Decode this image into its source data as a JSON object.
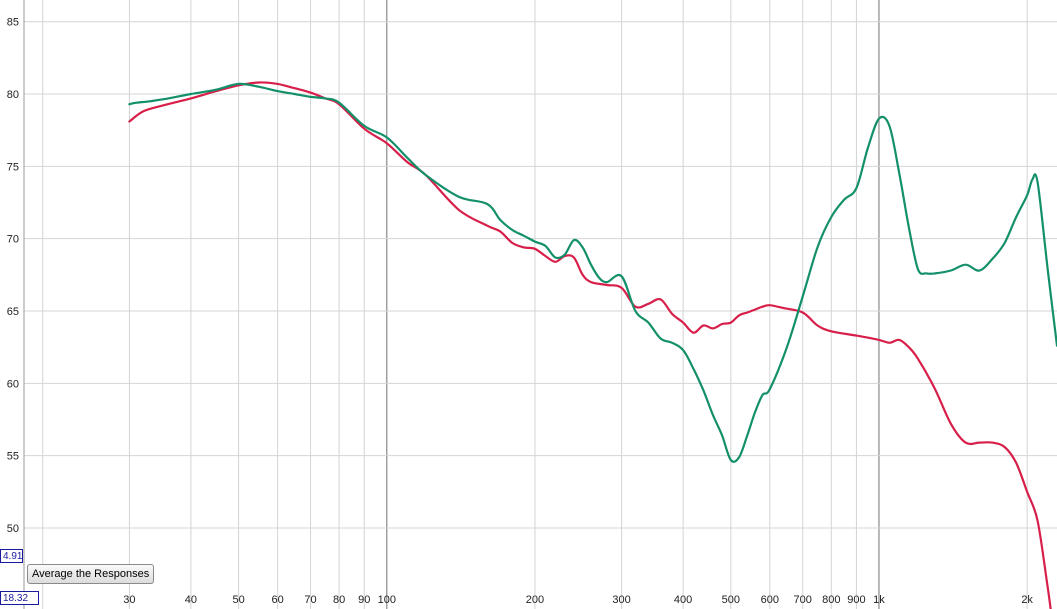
{
  "chart_data": {
    "type": "line",
    "x_scale": "log",
    "xlim": [
      18.32,
      2300
    ],
    "ylim": [
      44.4,
      86.5
    ],
    "grid": true,
    "x_ticks": [
      {
        "value": 30,
        "label": "30"
      },
      {
        "value": 40,
        "label": "40"
      },
      {
        "value": 50,
        "label": "50"
      },
      {
        "value": 60,
        "label": "60"
      },
      {
        "value": 70,
        "label": "70"
      },
      {
        "value": 80,
        "label": "80"
      },
      {
        "value": 90,
        "label": "90"
      },
      {
        "value": 100,
        "label": "100"
      },
      {
        "value": 200,
        "label": "200"
      },
      {
        "value": 300,
        "label": "300"
      },
      {
        "value": 400,
        "label": "400"
      },
      {
        "value": 500,
        "label": "500"
      },
      {
        "value": 600,
        "label": "600"
      },
      {
        "value": 700,
        "label": "700"
      },
      {
        "value": 800,
        "label": "800"
      },
      {
        "value": 900,
        "label": "900"
      },
      {
        "value": 1000,
        "label": "1k"
      },
      {
        "value": 2000,
        "label": "2k"
      }
    ],
    "y_ticks": [
      50,
      55,
      60,
      65,
      70,
      75,
      80,
      85
    ],
    "series": [
      {
        "color": "#d81f4a",
        "x": [
          30,
          32,
          35,
          40,
          45,
          50,
          55,
          60,
          65,
          70,
          75,
          80,
          90,
          100,
          110,
          120,
          140,
          160,
          170,
          180,
          190,
          200,
          210,
          220,
          230,
          240,
          250,
          260,
          280,
          300,
          320,
          340,
          360,
          380,
          400,
          420,
          440,
          460,
          480,
          500,
          520,
          540,
          560,
          580,
          600,
          640,
          700,
          750,
          800,
          900,
          1000,
          1050,
          1100,
          1150,
          1200,
          1300,
          1400,
          1500,
          1600,
          1700,
          1800,
          1900,
          2000,
          2100,
          2200,
          2250
        ],
        "y": [
          78.1,
          78.8,
          79.2,
          79.7,
          80.2,
          80.6,
          80.8,
          80.7,
          80.4,
          80.1,
          79.7,
          79.3,
          77.6,
          76.6,
          75.3,
          74.4,
          72.0,
          70.9,
          70.5,
          69.7,
          69.4,
          69.3,
          68.8,
          68.4,
          68.8,
          68.7,
          67.5,
          67.0,
          66.8,
          66.6,
          65.3,
          65.5,
          65.8,
          64.8,
          64.2,
          63.5,
          64.0,
          63.8,
          64.1,
          64.2,
          64.7,
          64.9,
          65.1,
          65.3,
          65.4,
          65.2,
          64.9,
          64.0,
          63.6,
          63.3,
          63.0,
          62.8,
          63.0,
          62.5,
          61.7,
          59.6,
          57.2,
          55.9,
          55.9,
          55.9,
          55.6,
          54.5,
          52.5,
          50.5,
          46.0,
          43.5
        ]
      },
      {
        "color": "#13906a",
        "x": [
          30,
          31,
          33,
          36,
          40,
          45,
          50,
          55,
          60,
          65,
          70,
          75,
          80,
          90,
          100,
          110,
          120,
          140,
          160,
          170,
          180,
          190,
          200,
          210,
          220,
          230,
          240,
          250,
          260,
          270,
          280,
          300,
          320,
          340,
          360,
          380,
          400,
          420,
          440,
          460,
          480,
          500,
          520,
          540,
          560,
          580,
          600,
          650,
          700,
          750,
          800,
          850,
          900,
          950,
          1000,
          1050,
          1100,
          1150,
          1200,
          1250,
          1300,
          1400,
          1500,
          1600,
          1700,
          1800,
          1900,
          2000,
          2050,
          2100,
          2200,
          2300
        ],
        "y": [
          79.3,
          79.4,
          79.5,
          79.7,
          80.0,
          80.3,
          80.7,
          80.5,
          80.2,
          80.0,
          79.8,
          79.7,
          79.4,
          77.8,
          77.0,
          75.6,
          74.4,
          72.9,
          72.4,
          71.3,
          70.6,
          70.2,
          69.8,
          69.5,
          68.7,
          68.9,
          69.9,
          69.4,
          68.2,
          67.3,
          67.0,
          67.4,
          65.0,
          64.2,
          63.1,
          62.8,
          62.3,
          61.0,
          59.5,
          57.8,
          56.4,
          54.7,
          54.9,
          56.4,
          58.0,
          59.2,
          59.6,
          62.5,
          66.0,
          69.4,
          71.5,
          72.7,
          73.5,
          76.3,
          78.3,
          77.8,
          74.5,
          70.8,
          67.9,
          67.6,
          67.6,
          67.8,
          68.2,
          67.8,
          68.6,
          69.7,
          71.5,
          73.0,
          74.1,
          73.9,
          68.0,
          62.6
        ]
      }
    ],
    "y_readout": "4.91",
    "x_readout": "18.32"
  },
  "controls": {
    "average_button": "Average the Responses"
  },
  "colors": {
    "grid_minor": "#d4d4d4",
    "grid_major": "#8a8a8a",
    "baseline": "#000000"
  }
}
